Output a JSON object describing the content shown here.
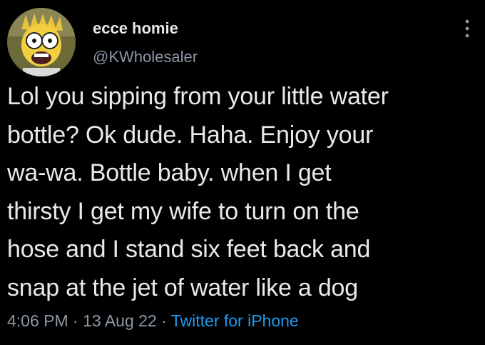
{
  "author": {
    "display_name": "ecce homie",
    "handle": "@KWholesaler",
    "avatar_icon": "cartoon-character-avatar"
  },
  "more_icon": "vertical-ellipsis-icon",
  "tweet": {
    "lines": [
      "Lol you sipping from your little water",
      "bottle? Ok dude. Haha. Enjoy your",
      "wa-wa. Bottle baby. when I get",
      "thirsty I get my wife to turn on the",
      "hose and I stand six feet back and",
      "snap at the jet of water like a dog"
    ]
  },
  "meta": {
    "time": "4:06 PM",
    "separator": " · ",
    "date": "13 Aug 22",
    "source": "Twitter for iPhone"
  },
  "colors": {
    "background": "#000000",
    "primary_text": "#e7e9ea",
    "secondary_text": "#8b98a5",
    "link": "#1d9bf0"
  }
}
